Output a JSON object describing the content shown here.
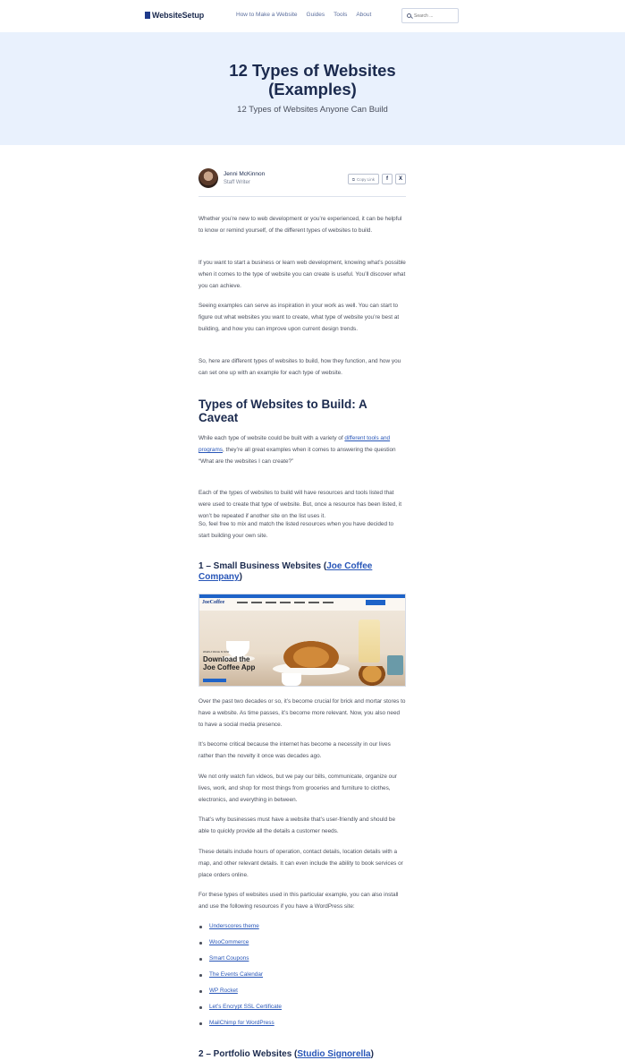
{
  "header": {
    "logo_text": "WebsiteSetup",
    "nav": [
      "How to Make a Website",
      "Guides",
      "Tools",
      "About"
    ],
    "search_placeholder": "Search ..."
  },
  "hero": {
    "title_line1": "12 Types of Websites",
    "title_line2": "(Examples)",
    "subtitle": "12 Types of Websites Anyone Can Build"
  },
  "author": {
    "name": "Jenni McKinnon",
    "role": "Staff Writer",
    "copy_link": "Copy Link",
    "facebook": "f",
    "x": "X"
  },
  "intro": [
    "Whether you’re new to web development or you’re experienced, it can be helpful to know or remind yourself, of the different types of websites to build.",
    "If you want to start a business or learn web development, knowing what’s possible when it comes to the type of website you can create is useful. You’ll discover what you can achieve.",
    "Seeing examples can serve as inspiration in your work as well. You can start to figure out what websites you want to create, what type of website you’re best at building, and how you can improve upon current design trends.",
    "So, here are different types of websites to build, how they function, and how you can set one up with an example for each type of website."
  ],
  "caveat": {
    "heading": "Types of Websites to Build: A Caveat",
    "p1_before": "While each type of website could be built with a variety of ",
    "p1_link": "different tools and programs",
    "p1_after": ", they’re all great examples when it comes to answering the question “What are the websites I can create?”",
    "p2": "Each of the types of websites to build will have resources and tools listed that were used to create that type of website. But, once a resource has been listed, it won’t be repeated if another site on the list uses it.",
    "p3": "So, feel free to mix and match the listed resources when you have decided to start building your own site."
  },
  "section1": {
    "heading_prefix": "1 – Small Business Websites (",
    "heading_link": "Joe Coffee Company",
    "heading_suffix": ")",
    "image": {
      "logo": "JoeCoffee",
      "kicker": "WHEN A WHILE IS NOW",
      "headline_line1": "Download the",
      "headline_line2": "Joe Coffee App"
    },
    "paragraphs": [
      "Over the past two decades or so, it’s become crucial for brick and mortar stores to have a website. As time passes, it’s become more relevant. Now, you also need to have a social media presence.",
      "It’s become critical because the internet has become a necessity in our lives rather than the novelty it once was decades ago.",
      "We not only watch fun videos, but we pay our bills, communicate, organize our lives, work, and shop for most things from groceries and furniture to clothes, electronics, and everything in between.",
      "That’s why businesses must have a website that’s user-friendly and should be able to quickly provide all the details a customer needs.",
      "These details include hours of operation, contact details, location details with a map, and other relevant details. It can even include the ability to book services or place orders online.",
      "For these types of websites used in this particular example, you can also install and use the following resources if you have a WordPress site:"
    ],
    "resources": [
      "Underscores theme",
      "WooCommerce",
      "Smart Coupons",
      "The Events Calendar",
      "WP Rocket",
      "Let’s Encrypt SSL Certificate",
      "MailChimp for WordPress"
    ]
  },
  "section2": {
    "heading_prefix": "2 – Portfolio Websites (",
    "heading_link": "Studio Signorella",
    "heading_suffix": ")"
  }
}
